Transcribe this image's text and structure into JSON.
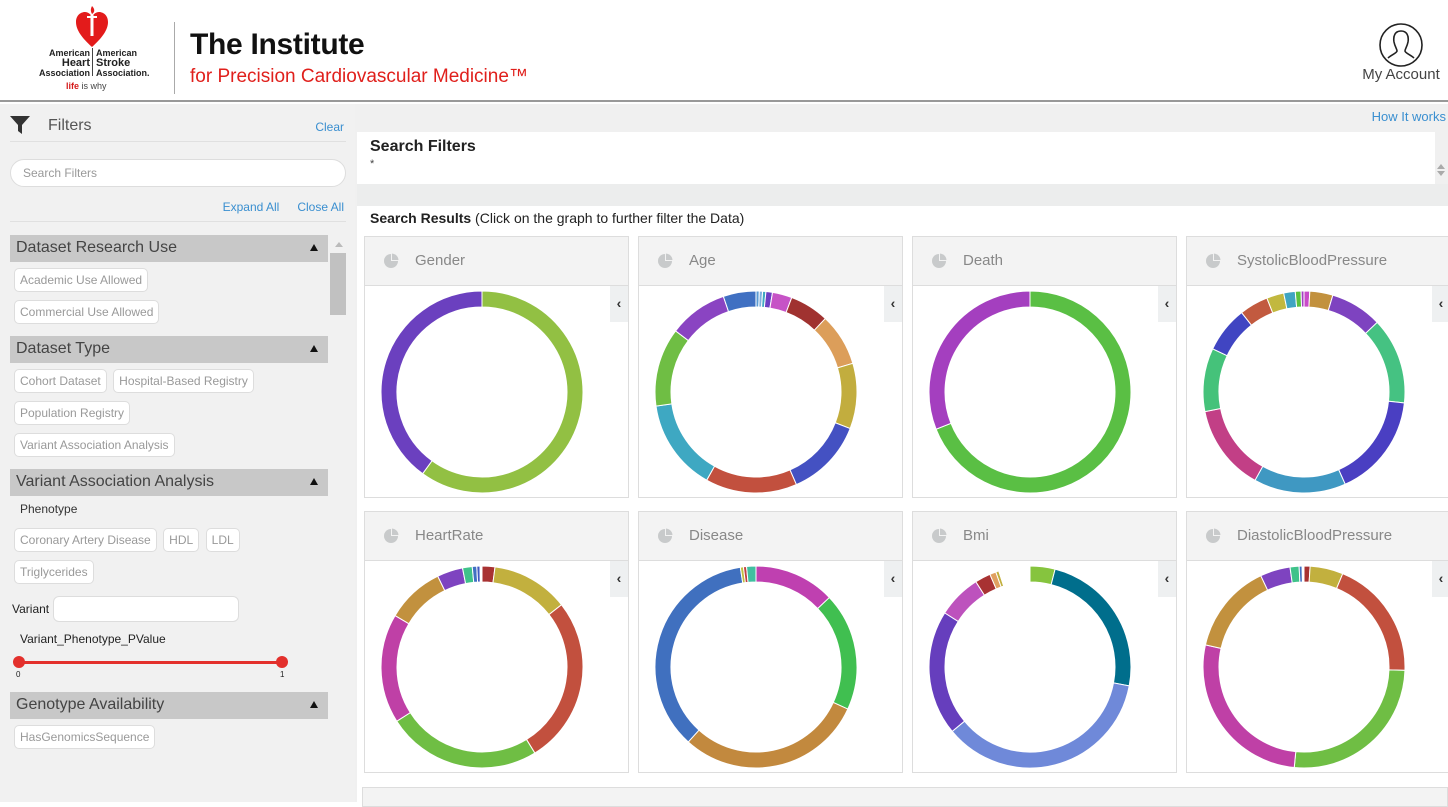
{
  "header": {
    "logo": {
      "left_col": [
        "American",
        "Heart",
        "Association"
      ],
      "right_col": [
        "American",
        "Stroke",
        "Association."
      ],
      "tagline_bold": "life",
      "tagline_rest": " is why",
      "brand_color": "#d51b1b"
    },
    "title": "The Institute",
    "subtitle": "for Precision Cardiovascular Medicine™",
    "account_label": "My Account"
  },
  "sidebar": {
    "title": "Filters",
    "clear_label": "Clear",
    "search_placeholder": "Search Filters",
    "expand_all": "Expand All",
    "close_all": "Close All",
    "sections": [
      {
        "title": "Dataset Research Use",
        "chips": [
          "Academic Use Allowed",
          "Commercial Use Allowed"
        ]
      },
      {
        "title": "Dataset Type",
        "chips": [
          "Cohort Dataset",
          "Hospital-Based Registry",
          "Population Registry",
          "Variant Association Analysis"
        ]
      },
      {
        "title": "Variant Association Analysis",
        "sub_label": "Phenotype",
        "chips": [
          "Coronary Artery Disease",
          "HDL",
          "LDL",
          "Triglycerides"
        ],
        "variant_label": "Variant",
        "variant_value": "",
        "slider_label": "Variant_Phenotype_PValue",
        "slider_min": "0",
        "slider_max": "1",
        "slider_range": [
          0,
          1
        ]
      },
      {
        "title": "Genotype Availability",
        "chips": [
          "HasGenomicsSequence"
        ]
      }
    ]
  },
  "main": {
    "how_it_works": "How It works",
    "search_filters_title": "Search Filters",
    "search_filters_value": "*",
    "results_title": "Search Results",
    "results_hint": " (Click on the graph to further filter the Data)",
    "toggle_glyph": "‹"
  },
  "chart_data": [
    {
      "type": "pie",
      "title": "Gender",
      "values": [
        60,
        40
      ],
      "colors": [
        "#92c043",
        "#6b40bf"
      ]
    },
    {
      "type": "pie",
      "title": "Age",
      "values": [
        0.5,
        0.5,
        0.5,
        1,
        3,
        6,
        8,
        10,
        12,
        14,
        14,
        12,
        9,
        5
      ],
      "colors": [
        "#5b9bd5",
        "#7fb0e0",
        "#3ea8c2",
        "#6c3fc4",
        "#c653c6",
        "#a03230",
        "#dc9e5a",
        "#c2ad3e",
        "#4451c2",
        "#c2503e",
        "#3ea8c2",
        "#6fbe44",
        "#8a44c2",
        "#4070c2"
      ]
    },
    {
      "type": "pie",
      "title": "Death",
      "values": [
        69,
        31
      ],
      "colors": [
        "#5abf44",
        "#a43fbf"
      ]
    },
    {
      "type": "pie",
      "title": "SystolicBloodPressure",
      "values": [
        1,
        4,
        9,
        15,
        18,
        16,
        15,
        11,
        8,
        5,
        3,
        2,
        1,
        0.5
      ],
      "colors": [
        "#c94bc9",
        "#c2913e",
        "#7e43c0",
        "#45c282",
        "#4a3fc2",
        "#3f98c2",
        "#c23f86",
        "#45c27a",
        "#4045c2",
        "#c25a3f",
        "#c2b83f",
        "#3fa5c2",
        "#5ac23f",
        "#a43fc2"
      ]
    },
    {
      "type": "pie",
      "title": "HeartRate",
      "values": [
        2,
        12,
        26,
        24,
        17,
        9,
        4,
        1.5,
        0.7,
        0.5,
        0.3
      ],
      "colors": [
        "#a83232",
        "#c2b03e",
        "#c2503e",
        "#6fbe44",
        "#bf40a6",
        "#c2913e",
        "#7e43c0",
        "#3fc28a",
        "#4070c2",
        "#3f58c2",
        "#ffffff"
      ]
    },
    {
      "type": "pie",
      "title": "Disease",
      "values": [
        13,
        19,
        30,
        36,
        0.5,
        0.5,
        1.5
      ],
      "colors": [
        "#bf40b0",
        "#40bf50",
        "#c2893e",
        "#4070bf",
        "#bfbf40",
        "#bf4040",
        "#40bfa0"
      ]
    },
    {
      "type": "pie",
      "title": "Bmi",
      "values": [
        4,
        24,
        36,
        20,
        7,
        2.5,
        1,
        0.5,
        0.3,
        4.7
      ],
      "colors": [
        "#86c43e",
        "#006e8c",
        "#6f89d9",
        "#663ebd",
        "#bd52bd",
        "#a83232",
        "#e0a060",
        "#c2b03e",
        "#ffffff",
        "#ffffff"
      ]
    },
    {
      "type": "pie",
      "title": "DiastolicBloodPressure",
      "values": [
        1,
        5.5,
        20,
        27,
        28,
        15,
        5,
        1.5,
        0.5,
        0.3
      ],
      "colors": [
        "#a83232",
        "#c2b03e",
        "#c2503e",
        "#6fbe44",
        "#bf40a6",
        "#c2913e",
        "#7e43c0",
        "#3fc28a",
        "#4070c2",
        "#ffffff"
      ]
    }
  ]
}
